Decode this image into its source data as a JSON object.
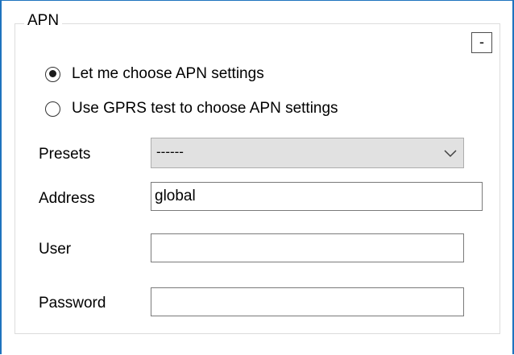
{
  "group": {
    "title": "APN",
    "collapse_label": "-"
  },
  "radios": [
    {
      "label": "Let me choose APN settings",
      "checked": true
    },
    {
      "label": "Use GPRS test to choose APN settings",
      "checked": false
    }
  ],
  "fields": {
    "presets": {
      "label": "Presets",
      "value": "------"
    },
    "address": {
      "label": "Address",
      "value": "global"
    },
    "user": {
      "label": "User",
      "value": ""
    },
    "password": {
      "label": "Password",
      "value": ""
    }
  },
  "colors": {
    "window_border": "#1e73be",
    "combo_background": "#e1e1e1",
    "groupbox_border": "#dcdcdc"
  },
  "icons": {
    "combo_arrow": "chevron-down-icon",
    "radio_selected": "radio-selected-icon",
    "radio_unselected": "radio-unselected-icon"
  }
}
